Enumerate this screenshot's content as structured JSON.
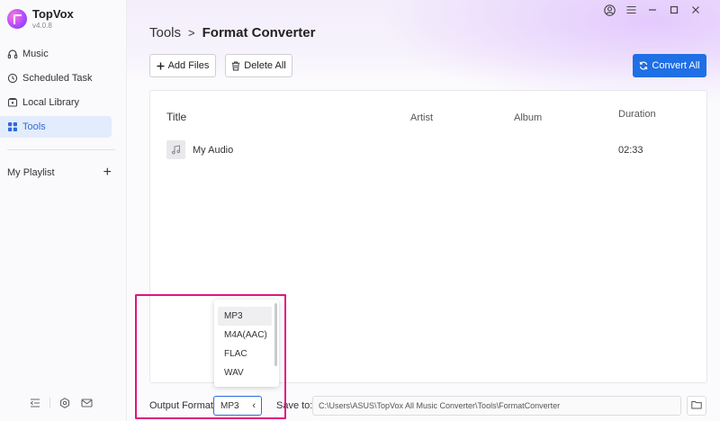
{
  "app": {
    "name": "TopVox",
    "version": "v4.0.8"
  },
  "sidebar": {
    "items": [
      {
        "label": "Music",
        "icon": "headphones-icon"
      },
      {
        "label": "Scheduled Task",
        "icon": "clock-icon"
      },
      {
        "label": "Local Library",
        "icon": "library-icon"
      },
      {
        "label": "Tools",
        "icon": "grid-icon",
        "active": true
      }
    ],
    "playlist_label": "My Playlist",
    "bottom_icons": [
      "collapse-icon",
      "settings-icon",
      "mail-icon"
    ]
  },
  "header": {
    "breadcrumb_parent": "Tools",
    "breadcrumb_sep": ">",
    "breadcrumb_current": "Format Converter"
  },
  "toolbar": {
    "add_label": "Add Files",
    "delete_label": "Delete All",
    "convert_label": "Convert All"
  },
  "table": {
    "headers": {
      "title": "Title",
      "artist": "Artist",
      "album": "Album",
      "duration": "Duration"
    },
    "rows": [
      {
        "title": "My Audio",
        "artist": "",
        "album": "",
        "duration": "02:33"
      }
    ]
  },
  "bottom_bar": {
    "output_label": "Output Format:",
    "format_value": "MP3",
    "save_label": "Save to:",
    "save_path": "C:\\Users\\ASUS\\TopVox All Music Converter\\Tools\\FormatConverter"
  },
  "format_dropdown": {
    "options": [
      "MP3",
      "M4A(AAC)",
      "FLAC",
      "WAV"
    ],
    "selected": "MP3"
  },
  "colors": {
    "accent": "#1f6fe5",
    "active_nav_bg": "#e3ecfc",
    "highlight_border": "#e0157f"
  }
}
